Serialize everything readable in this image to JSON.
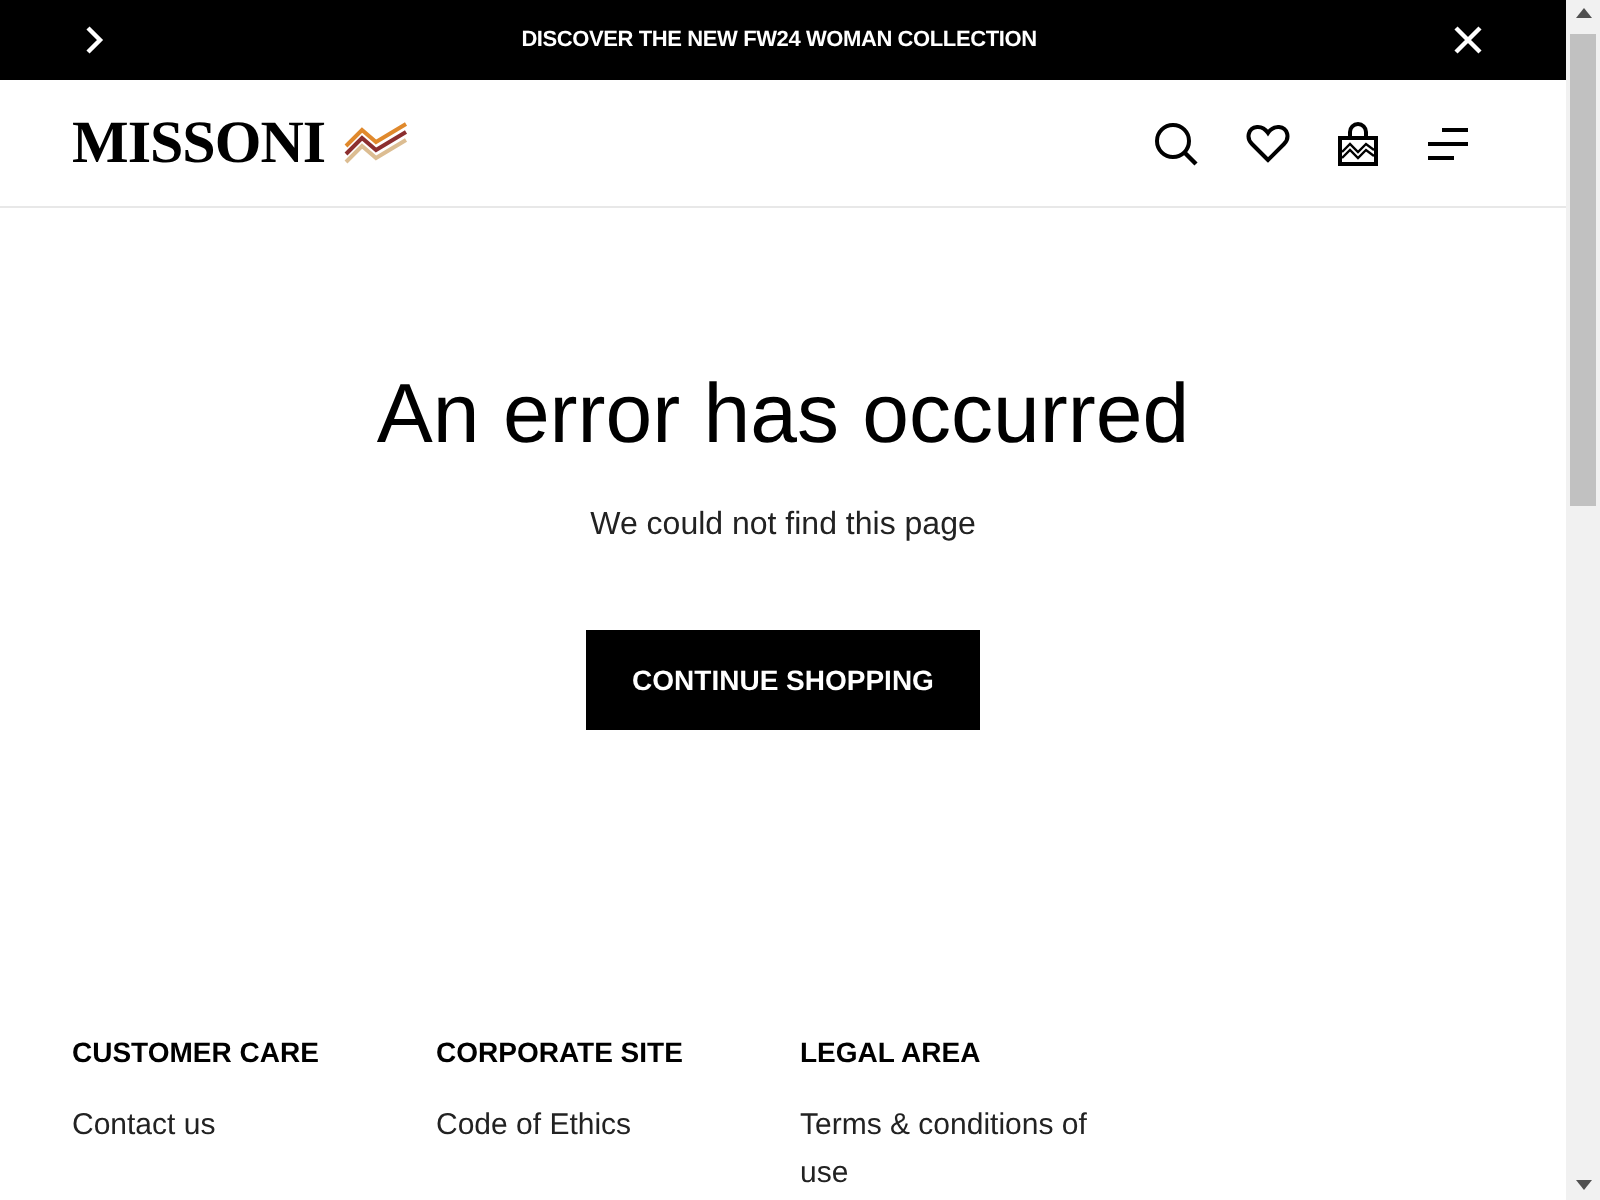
{
  "announcement_bar": {
    "text": "DISCOVER THE NEW FW24 WOMAN COLLECTION"
  },
  "header": {
    "logo": "MISSONI"
  },
  "error": {
    "title": "An error has occurred",
    "message": "We could not find this page",
    "button": "CONTINUE SHOPPING"
  },
  "footer": {
    "columns": [
      {
        "heading": "CUSTOMER CARE",
        "links": [
          "Contact us"
        ]
      },
      {
        "heading": "CORPORATE SITE",
        "links": [
          "Code of Ethics"
        ]
      },
      {
        "heading": "LEGAL AREA",
        "links": [
          "Terms & conditions of use"
        ]
      }
    ]
  }
}
